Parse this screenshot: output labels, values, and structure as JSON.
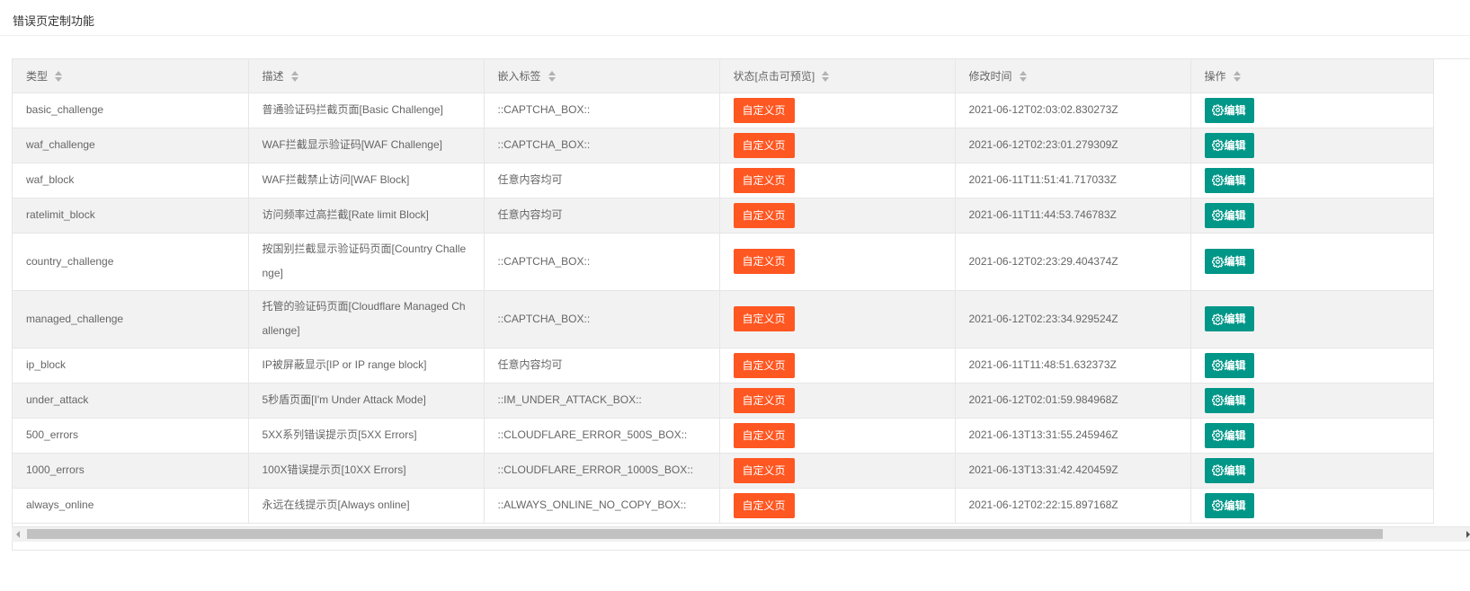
{
  "page": {
    "title": "错误页定制功能"
  },
  "table": {
    "columns": [
      "类型",
      "描述",
      "嵌入标签",
      "状态[点击可预览]",
      "修改时间",
      "操作"
    ],
    "custom_label": "自定义页",
    "edit_label": "编辑",
    "rows": [
      {
        "type": "basic_challenge",
        "desc": "普通验证码拦截页面[Basic Challenge]",
        "tag": "::CAPTCHA_BOX::",
        "time": "2021-06-12T02:03:02.830273Z"
      },
      {
        "type": "waf_challenge",
        "desc": "WAF拦截显示验证码[WAF Challenge]",
        "tag": "::CAPTCHA_BOX::",
        "time": "2021-06-12T02:23:01.279309Z"
      },
      {
        "type": "waf_block",
        "desc": "WAF拦截禁止访问[WAF Block]",
        "tag": "任意内容均可",
        "time": "2021-06-11T11:51:41.717033Z"
      },
      {
        "type": "ratelimit_block",
        "desc": "访问频率过高拦截[Rate limit Block]",
        "tag": "任意内容均可",
        "time": "2021-06-11T11:44:53.746783Z"
      },
      {
        "type": "country_challenge",
        "desc": "按国别拦截显示验证码页面[Country Challenge]",
        "tag": "::CAPTCHA_BOX::",
        "time": "2021-06-12T02:23:29.404374Z"
      },
      {
        "type": "managed_challenge",
        "desc": "托管的验证码页面[Cloudflare Managed Challenge]",
        "tag": "::CAPTCHA_BOX::",
        "time": "2021-06-12T02:23:34.929524Z"
      },
      {
        "type": "ip_block",
        "desc": "IP被屏蔽显示[IP or IP range block]",
        "tag": "任意内容均可",
        "time": "2021-06-11T11:48:51.632373Z"
      },
      {
        "type": "under_attack",
        "desc": "5秒盾页面[I'm Under Attack Mode]",
        "tag": "::IM_UNDER_ATTACK_BOX::",
        "time": "2021-06-12T02:01:59.984968Z"
      },
      {
        "type": "500_errors",
        "desc": "5XX系列错误提示页[5XX Errors]",
        "tag": "::CLOUDFLARE_ERROR_500S_BOX::",
        "time": "2021-06-13T13:31:55.245946Z"
      },
      {
        "type": "1000_errors",
        "desc": "100X错误提示页[10XX Errors]",
        "tag": "::CLOUDFLARE_ERROR_1000S_BOX::",
        "time": "2021-06-13T13:31:42.420459Z"
      },
      {
        "type": "always_online",
        "desc": "永远在线提示页[Always online]",
        "tag": "::ALWAYS_ONLINE_NO_COPY_BOX::",
        "time": "2021-06-12T02:22:15.897168Z"
      }
    ]
  },
  "icons": {
    "sort": "sort-icon",
    "edit": "gear-icon",
    "scroll_left": "arrow-left-icon",
    "scroll_right": "arrow-right-icon"
  },
  "colors": {
    "custom_button": "#ff5722",
    "edit_button": "#009688",
    "header_bg": "#f2f2f2",
    "border": "#e6e6e6"
  }
}
